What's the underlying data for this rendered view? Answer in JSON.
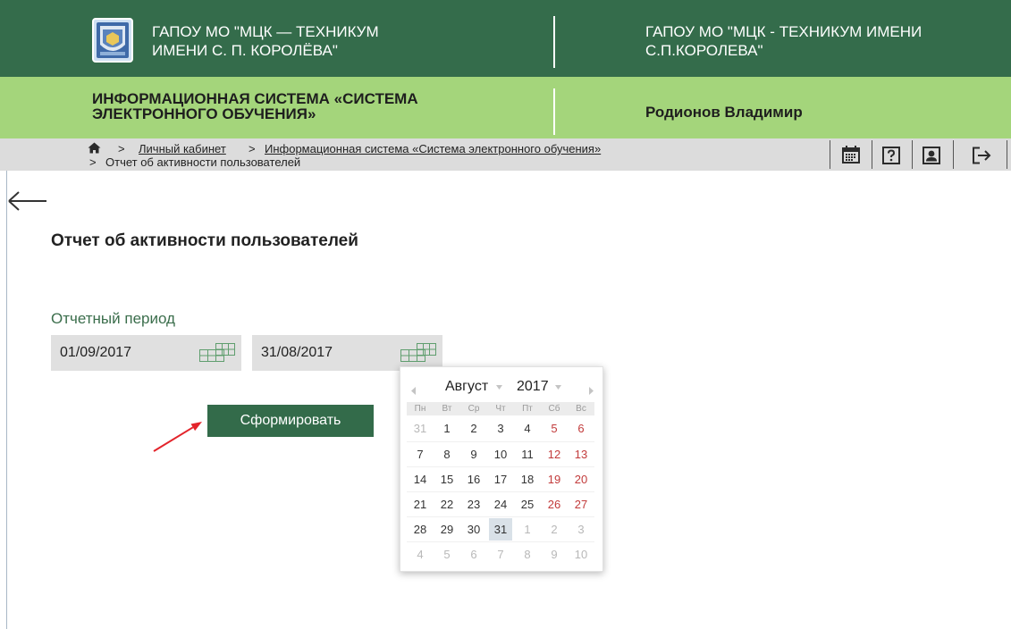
{
  "colors": {
    "header_dark_green": "#346c4b",
    "header_light_green": "#a4d57b",
    "breadcrumb_bar": "#dcdcdc",
    "accent_green": "#336b4a",
    "weekend_red": "#c23b3b",
    "annotation_red": "#e3242b"
  },
  "header": {
    "logo_icon": "college-emblem-icon",
    "org_left": {
      "line1": "ГАПОУ МО \"МЦК — ТЕХНИКУМ",
      "line2": "ИМЕНИ С. П. КОРОЛЁВА\""
    },
    "org_right": {
      "line1": "ГАПОУ МО \"МЦК - ТЕХНИКУМ ИМЕНИ",
      "line2": "С.П.КОРОЛЕВА\""
    }
  },
  "subheader": {
    "system_title": {
      "line1": "ИНФОРМАЦИОННАЯ СИСТЕМА «СИСТЕМА",
      "line2": "ЭЛЕКТРОННОГО ОБУЧЕНИЯ»"
    },
    "user_name": "Родионов Владимир"
  },
  "breadcrumb": {
    "home_icon": "home-icon",
    "separator": ">",
    "items": [
      {
        "label": "Личный кабинет"
      },
      {
        "label": "Информационная система «Система электронного обучения»"
      },
      {
        "label": "Отчет об активности пользователей"
      }
    ]
  },
  "toolbar": {
    "icons": [
      "calendar-icon",
      "help-icon",
      "profile-icon",
      "logout-icon"
    ]
  },
  "page": {
    "back_icon": "back-arrow-icon",
    "title": "Отчет об активности пользователей",
    "period_label": "Отчетный период",
    "date_from": {
      "value": "01/09/2017",
      "icon": "calendar-grid-icon"
    },
    "date_to": {
      "value": "31/08/2017",
      "icon": "calendar-grid-icon"
    },
    "submit_label": "Сформировать"
  },
  "datepicker": {
    "month": "Август",
    "year": "2017",
    "weekdays": [
      "Пн",
      "Вт",
      "Ср",
      "Чт",
      "Пт",
      "Сб",
      "Вс"
    ],
    "weeks": [
      [
        {
          "day": "31",
          "other_month": true
        },
        {
          "day": "1"
        },
        {
          "day": "2"
        },
        {
          "day": "3"
        },
        {
          "day": "4"
        },
        {
          "day": "5"
        },
        {
          "day": "6"
        }
      ],
      [
        {
          "day": "7"
        },
        {
          "day": "8"
        },
        {
          "day": "9"
        },
        {
          "day": "10"
        },
        {
          "day": "11"
        },
        {
          "day": "12"
        },
        {
          "day": "13"
        }
      ],
      [
        {
          "day": "14"
        },
        {
          "day": "15"
        },
        {
          "day": "16"
        },
        {
          "day": "17"
        },
        {
          "day": "18"
        },
        {
          "day": "19"
        },
        {
          "day": "20"
        }
      ],
      [
        {
          "day": "21"
        },
        {
          "day": "22"
        },
        {
          "day": "23"
        },
        {
          "day": "24"
        },
        {
          "day": "25"
        },
        {
          "day": "26"
        },
        {
          "day": "27"
        }
      ],
      [
        {
          "day": "28"
        },
        {
          "day": "29"
        },
        {
          "day": "30"
        },
        {
          "day": "31",
          "selected": true
        },
        {
          "day": "1",
          "other_month": true
        },
        {
          "day": "2",
          "other_month": true
        },
        {
          "day": "3",
          "other_month": true
        }
      ],
      [
        {
          "day": "4",
          "other_month": true
        },
        {
          "day": "5",
          "other_month": true
        },
        {
          "day": "6",
          "other_month": true
        },
        {
          "day": "7",
          "other_month": true
        },
        {
          "day": "8",
          "other_month": true
        },
        {
          "day": "9",
          "other_month": true
        },
        {
          "day": "10",
          "other_month": true
        }
      ]
    ]
  }
}
